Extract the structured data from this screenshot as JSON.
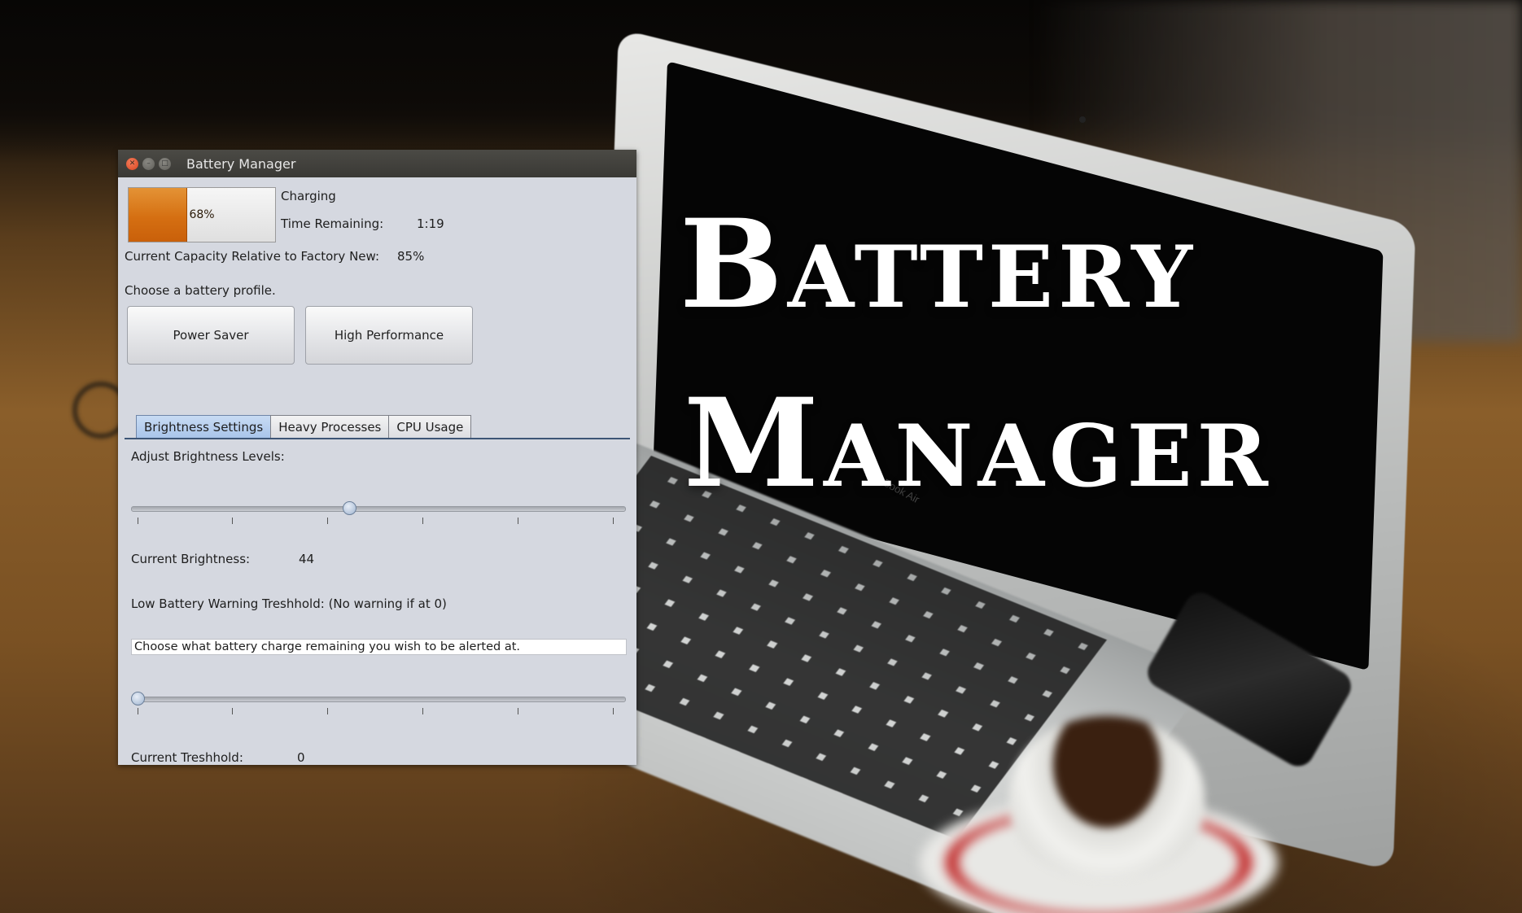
{
  "poster": {
    "title_line1": "Battery",
    "title_line2": "Manager",
    "laptop_label": "MacBook Air"
  },
  "window": {
    "title": "Battery Manager",
    "controls": [
      "close",
      "minimize",
      "maximize"
    ]
  },
  "battery": {
    "percent_label": "68%",
    "level_percent": 68,
    "status": "Charging",
    "time_remaining_label": "Time Remaining:",
    "time_remaining_value": "1:19",
    "capacity_label": "Current Capacity Relative to Factory New:",
    "capacity_value": "85%",
    "fill_color": "#d56f12"
  },
  "profiles": {
    "prompt": "Choose a battery profile.",
    "power_saver_label": "Power Saver",
    "high_performance_label": "High Performance"
  },
  "tabs": [
    {
      "label": "Brightness Settings",
      "active": true
    },
    {
      "label": "Heavy Processes",
      "active": false
    },
    {
      "label": "CPU Usage",
      "active": false
    }
  ],
  "brightness": {
    "heading": "Adjust Brightness Levels:",
    "slider_value": 44,
    "slider_min": 0,
    "slider_max": 100,
    "current_label": "Current Brightness:",
    "current_value": "44"
  },
  "warning": {
    "heading": "Low Battery Warning Treshhold: (No warning if at 0)",
    "field_text": "Choose what battery charge remaining you wish to be alerted at.",
    "slider_value": 0,
    "slider_min": 0,
    "slider_max": 100,
    "current_label": "Current Treshhold:",
    "current_value": "0"
  }
}
